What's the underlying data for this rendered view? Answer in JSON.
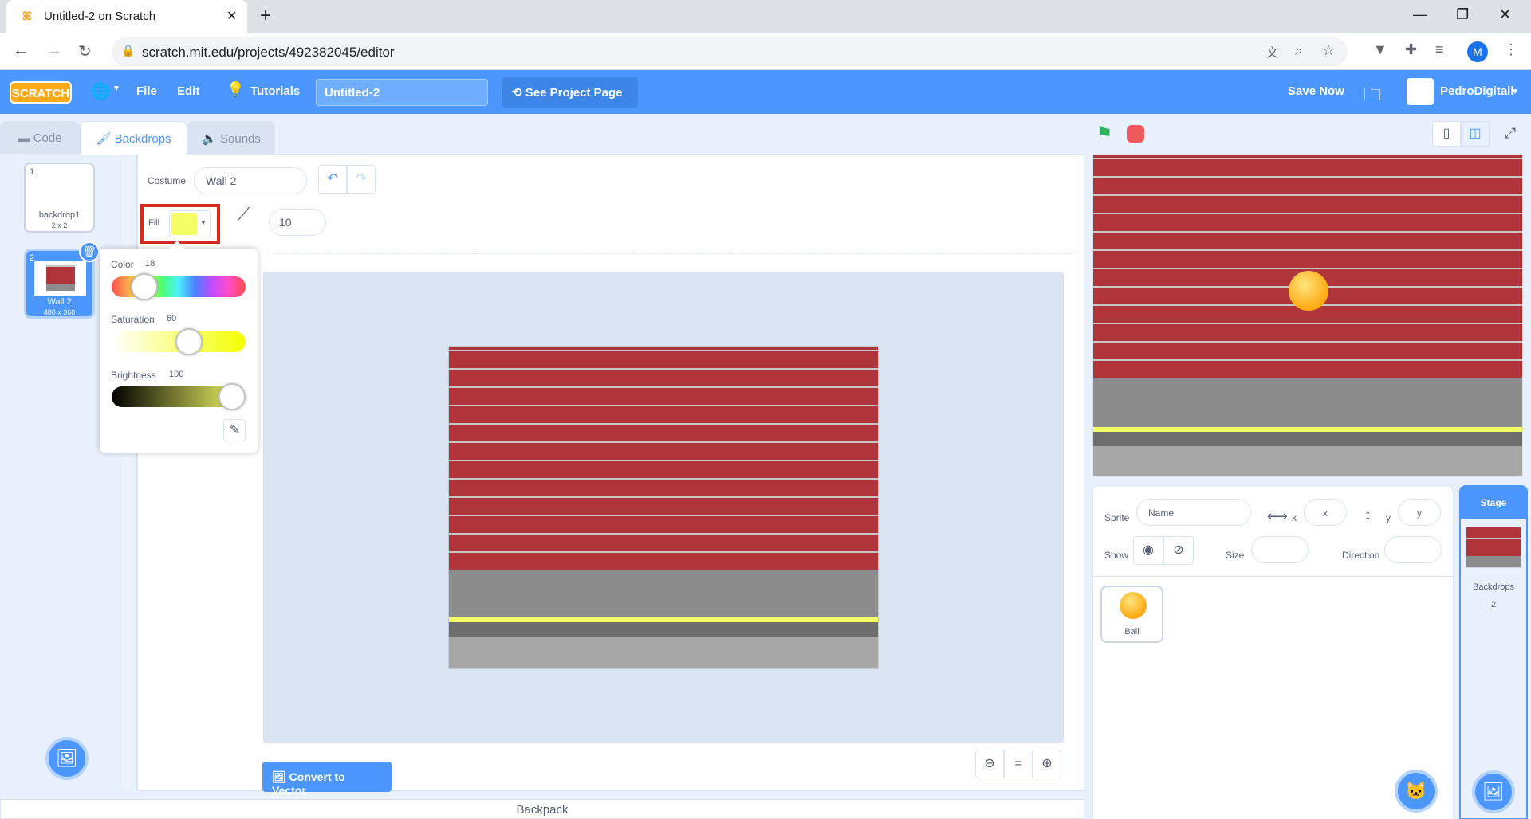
{
  "browser": {
    "tab_title": "Untitled-2 on Scratch",
    "url": "scratch.mit.edu/projects/492382045/editor",
    "profile_initial": "M"
  },
  "menu": {
    "logo": "SCRATCH",
    "file": "File",
    "edit": "Edit",
    "tutorials": "Tutorials",
    "project_title": "Untitled-2",
    "see_project_page": "See Project Page",
    "save_now": "Save Now",
    "username": "PedroDigitall"
  },
  "tabs": {
    "code": "Code",
    "backdrops": "Backdrops",
    "sounds": "Sounds"
  },
  "costumes": [
    {
      "index": "1",
      "name": "backdrop1",
      "size": "2 x 2"
    },
    {
      "index": "2",
      "name": "Wall 2",
      "size": "480 x 360"
    }
  ],
  "paint": {
    "costume_label": "Costume",
    "costume_name": "Wall 2",
    "fill_label": "Fill",
    "fill_color": "#f4ff66",
    "outline_width": "10",
    "convert_button": "Convert to Vector"
  },
  "color_picker": {
    "color_label": "Color",
    "color_value": "18",
    "color_level": 0.18,
    "saturation_label": "Saturation",
    "saturation_value": "60",
    "saturation_level": 0.6,
    "brightness_label": "Brightness",
    "brightness_value": "100",
    "brightness_level": 1.0
  },
  "sprite_info": {
    "sprite_label": "Sprite",
    "name_placeholder": "Name",
    "x_label": "x",
    "x_placeholder": "x",
    "y_label": "y",
    "y_placeholder": "y",
    "show_label": "Show",
    "size_label": "Size",
    "direction_label": "Direction"
  },
  "sprites": [
    {
      "name": "Ball"
    }
  ],
  "stage_panel": {
    "title": "Stage",
    "backdrops_label": "Backdrops",
    "backdrops_count": "2"
  },
  "backpack": "Backpack"
}
